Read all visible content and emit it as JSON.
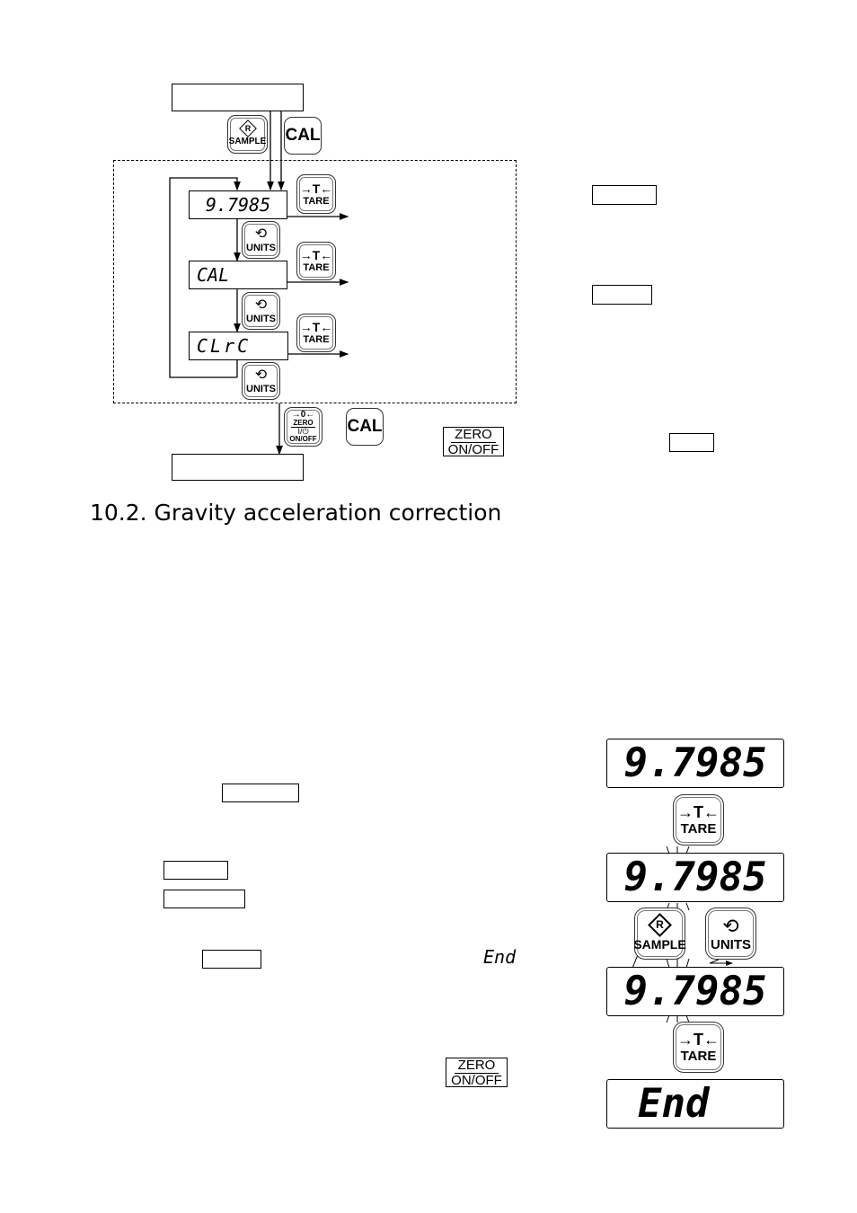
{
  "section": {
    "heading": "10.2. Gravity acceleration correction"
  },
  "flow_diagram": {
    "keys": {
      "sample_label": "SAMPLE",
      "sample_symbol": "R",
      "cal_label": "CAL",
      "tare_label": "TARE",
      "tare_symbol": "→T←",
      "units_label": "UNITS",
      "units_symbol": "⟲",
      "zero_symbol": "→0←",
      "zero_label": "ZERO",
      "power_symbol": "I/⏻",
      "onoff_label": "ON/OFF"
    },
    "displays": [
      {
        "text": "9.7985"
      },
      {
        "text": "CAL"
      },
      {
        "text": "CLrC"
      }
    ],
    "ref_key": {
      "top": "ZERO",
      "bottom": "ON/OFF"
    }
  },
  "procedure": {
    "end_glyph": "End",
    "ref_key": {
      "top": "ZERO",
      "bottom": "ON/OFF"
    }
  },
  "illustration": {
    "displays": [
      {
        "text": "9.7985"
      },
      {
        "text": "9.7985"
      },
      {
        "text": "9.7985"
      },
      {
        "text": "End"
      }
    ],
    "keys": {
      "tare_symbol": "→T←",
      "tare_label": "TARE",
      "sample_symbol": "R",
      "sample_label": "SAMPLE",
      "units_symbol": "⟲",
      "units_label": "UNITS"
    }
  }
}
